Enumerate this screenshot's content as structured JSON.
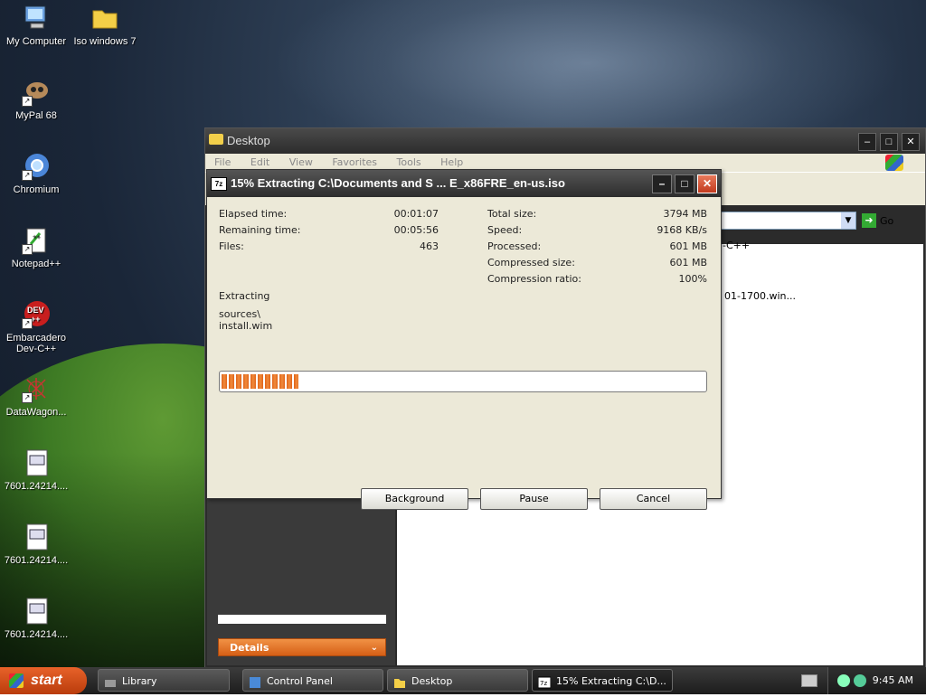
{
  "desktop": {
    "icons": [
      {
        "label": "My Computer"
      },
      {
        "label": "Iso windows 7"
      },
      {
        "label": "MyPal 68"
      },
      {
        "label": "Chromium"
      },
      {
        "label": "Notepad++"
      },
      {
        "label": "Embarcadero Dev-C++"
      },
      {
        "label": "DataWagon..."
      },
      {
        "label": "7601.24214...."
      },
      {
        "label": "7601.24214...."
      },
      {
        "label": "7601.24214...."
      }
    ]
  },
  "explorer": {
    "title": "Desktop",
    "menu": [
      "File",
      "Edit",
      "View",
      "Favorites",
      "Tools",
      "Help"
    ],
    "go_label": "Go",
    "visible_items": [
      "-C++",
      "01-1700.win..."
    ],
    "details_label": "Details"
  },
  "dialog": {
    "title": "15% Extracting C:\\Documents and S ... E_x86FRE_en-us.iso",
    "elapsed_label": "Elapsed time:",
    "elapsed_value": "00:01:07",
    "remaining_label": "Remaining time:",
    "remaining_value": "00:05:56",
    "files_label": "Files:",
    "files_value": "463",
    "total_size_label": "Total size:",
    "total_size_value": "3794 MB",
    "speed_label": "Speed:",
    "speed_value": "9168 KB/s",
    "processed_label": "Processed:",
    "processed_value": "601 MB",
    "compressed_label": "Compressed size:",
    "compressed_value": "601 MB",
    "ratio_label": "Compression ratio:",
    "ratio_value": "100%",
    "status_label": "Extracting",
    "current_path": "sources\\",
    "current_file": "install.wim",
    "progress_fraction": 0.16,
    "buttons": {
      "background": "Background",
      "pause": "Pause",
      "cancel": "Cancel"
    }
  },
  "taskbar": {
    "start_label": "start",
    "tasks": [
      {
        "label": "Library"
      },
      {
        "label": "Control Panel"
      },
      {
        "label": "Desktop"
      },
      {
        "label": "15% Extracting C:\\D..."
      }
    ],
    "clock": "9:45 AM"
  },
  "colors": {
    "progress_orange": "#e0641a",
    "close_red": "#c23a1e",
    "details_orange": "#d55f16"
  }
}
